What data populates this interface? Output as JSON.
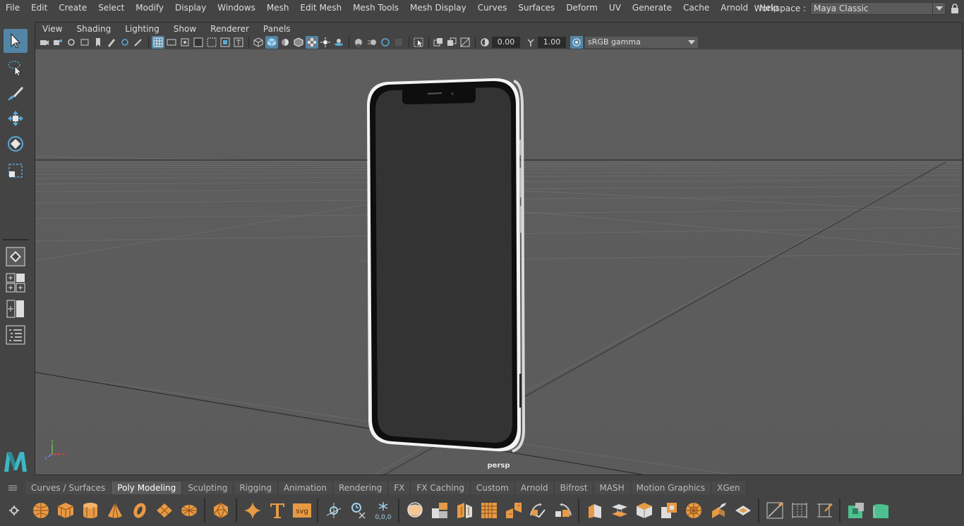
{
  "menubar": {
    "items": [
      "File",
      "Edit",
      "Create",
      "Select",
      "Modify",
      "Display",
      "Windows",
      "Mesh",
      "Edit Mesh",
      "Mesh Tools",
      "Mesh Display",
      "Curves",
      "Surfaces",
      "Deform",
      "UV",
      "Generate",
      "Cache",
      "Arnold",
      "Help"
    ],
    "workspace_label": "Workspace :",
    "workspace_value": "Maya Classic"
  },
  "panel": {
    "menu": [
      "View",
      "Shading",
      "Lighting",
      "Show",
      "Renderer",
      "Panels"
    ],
    "exposure": "0.00",
    "gamma": "1.00",
    "color_space": "sRGB gamma",
    "camera_label": "persp"
  },
  "shelf": {
    "tabs": [
      "Curves / Surfaces",
      "Poly Modeling",
      "Sculpting",
      "Rigging",
      "Animation",
      "Rendering",
      "FX",
      "FX Caching",
      "Custom",
      "Arnold",
      "Bifrost",
      "MASH",
      "Motion Graphics",
      "XGen"
    ],
    "active_tab": "Poly Modeling",
    "svg_label": "svg",
    "coord_label": "0,0,0"
  },
  "colors": {
    "accent": "#5285a6",
    "shelf_orange": "#e79a45",
    "maya_teal": "#3eb7c4"
  }
}
